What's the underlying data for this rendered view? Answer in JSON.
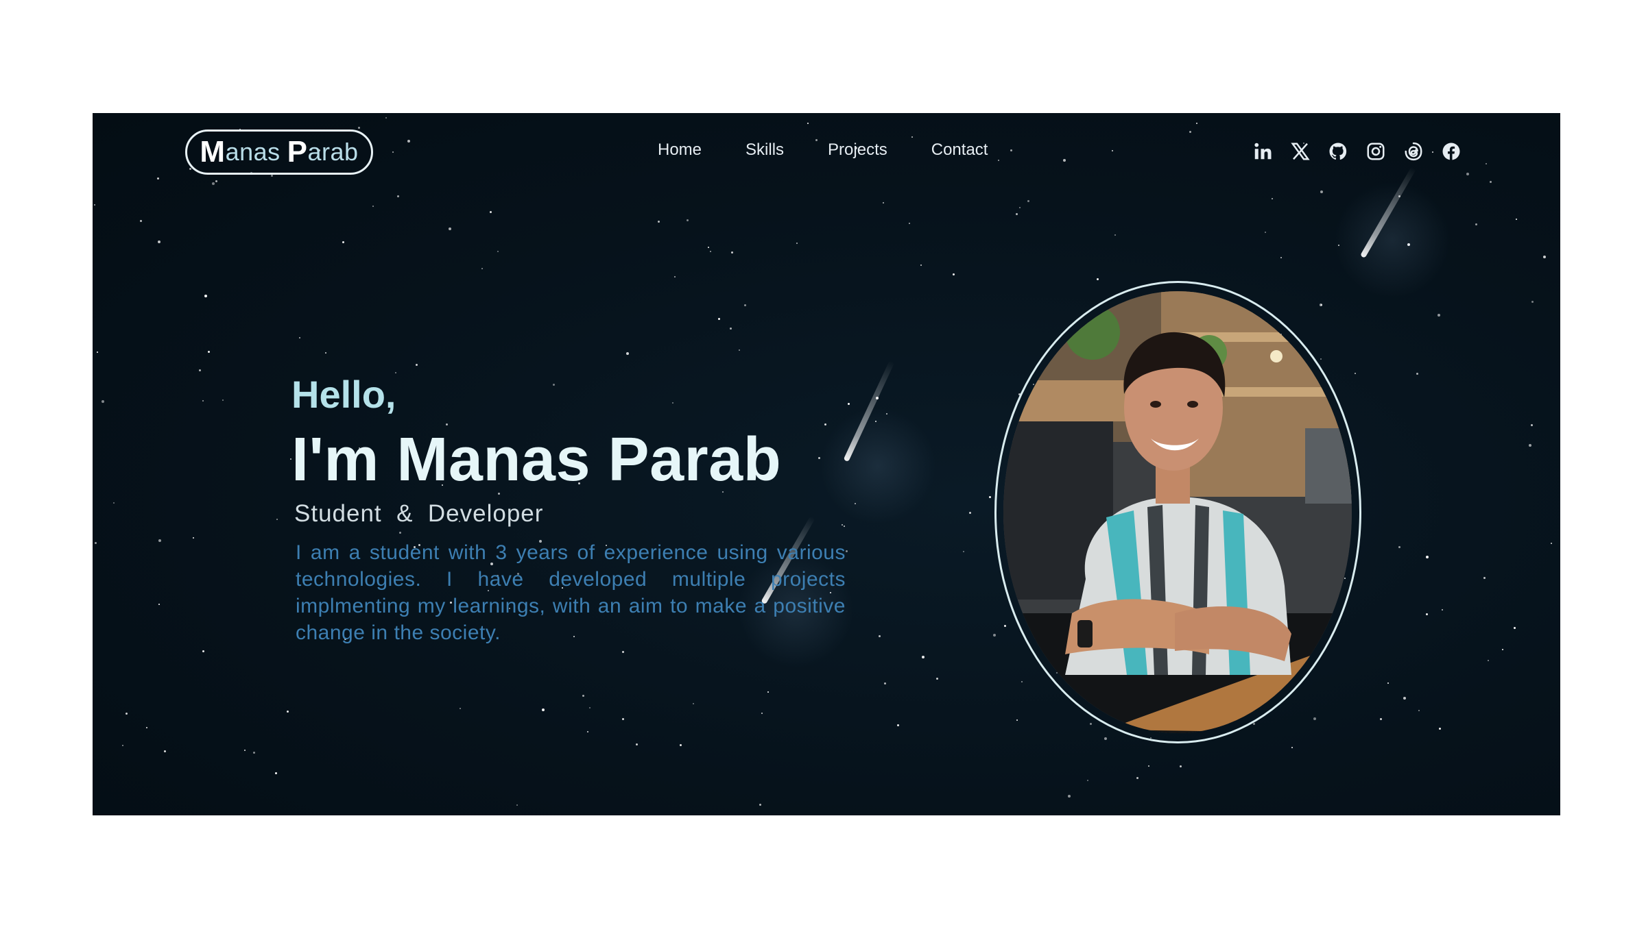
{
  "logo": {
    "initial1": "M",
    "rest1": "anas",
    "initial2": "P",
    "rest2": "arab"
  },
  "nav": {
    "items": [
      "Home",
      "Skills",
      "Projects",
      "Contact"
    ]
  },
  "socials": [
    "linkedin-icon",
    "x-twitter-icon",
    "github-icon",
    "instagram-icon",
    "threads-icon",
    "facebook-icon"
  ],
  "hero": {
    "greeting": "Hello,",
    "name": "I'm Manas Parab",
    "role": "Student  &  Developer",
    "bio": "I am a student with 3 years of experience using various technologies. I have developed multiple projects implmenting my learnings, with an aim to make a positive change in the society."
  },
  "colors": {
    "background": "#06121b",
    "accent": "#b5e2ea",
    "bio": "#3d7fb2",
    "text": "#e6edf2"
  }
}
